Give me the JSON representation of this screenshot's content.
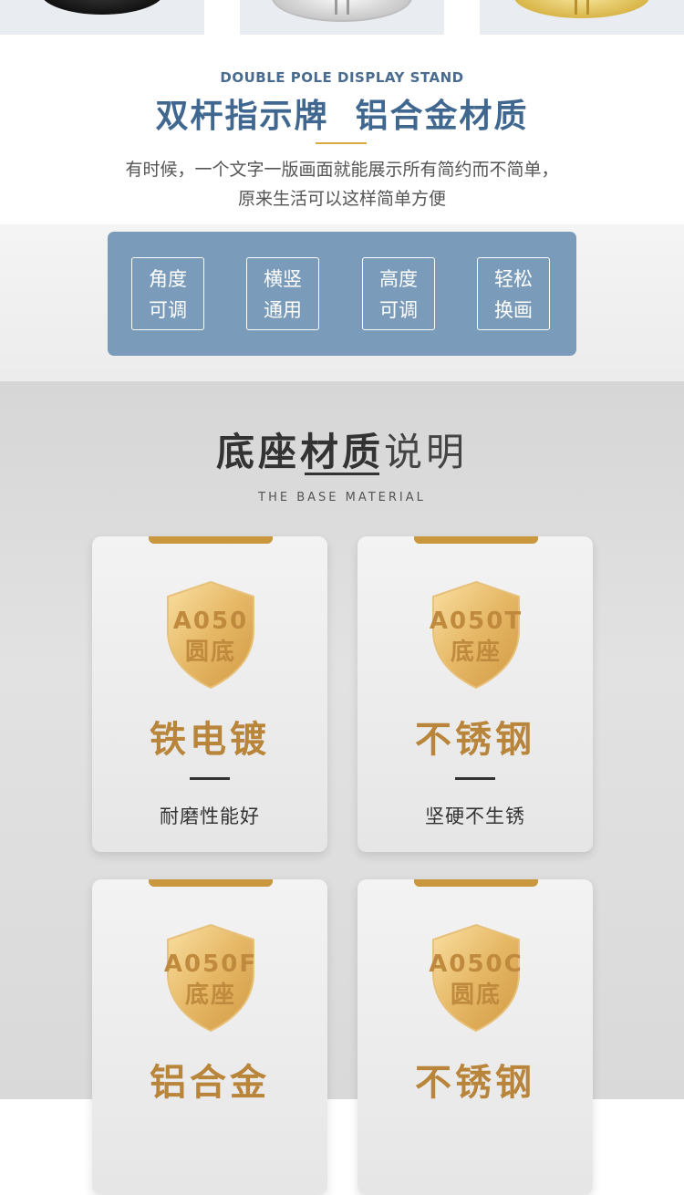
{
  "intro": {
    "en_title": "DOUBLE POLE DISPLAY STAND",
    "cn_title": "双杆指示牌  铝合金材质",
    "desc_line1": "有时候，一个文字一版画面就能展示所有简约而不简单，",
    "desc_line2": "原来生活可以这样简单方便"
  },
  "features": [
    {
      "line1": "角度",
      "line2": "可调"
    },
    {
      "line1": "横竖",
      "line2": "通用"
    },
    {
      "line1": "高度",
      "line2": "可调"
    },
    {
      "line1": "轻松",
      "line2": "换画"
    }
  ],
  "material": {
    "title_bold": "底座材质",
    "title_light": "说明",
    "subtitle": "THE BASE MATERIAL",
    "cards": [
      {
        "model": "A050",
        "type": "圆底",
        "name": "铁电镀",
        "feature": "耐磨性能好"
      },
      {
        "model": "A050T",
        "type": "底座",
        "name": "不锈钢",
        "feature": "坚硬不生锈"
      },
      {
        "model": "A050F",
        "type": "底座",
        "name": "铝合金",
        "feature": ""
      },
      {
        "model": "A050C",
        "type": "圆底",
        "name": "不锈钢",
        "feature": ""
      }
    ]
  },
  "colors": {
    "accent_blue": "#7a9bb9",
    "title_blue": "#3f6790",
    "gold": "#c8973e"
  }
}
